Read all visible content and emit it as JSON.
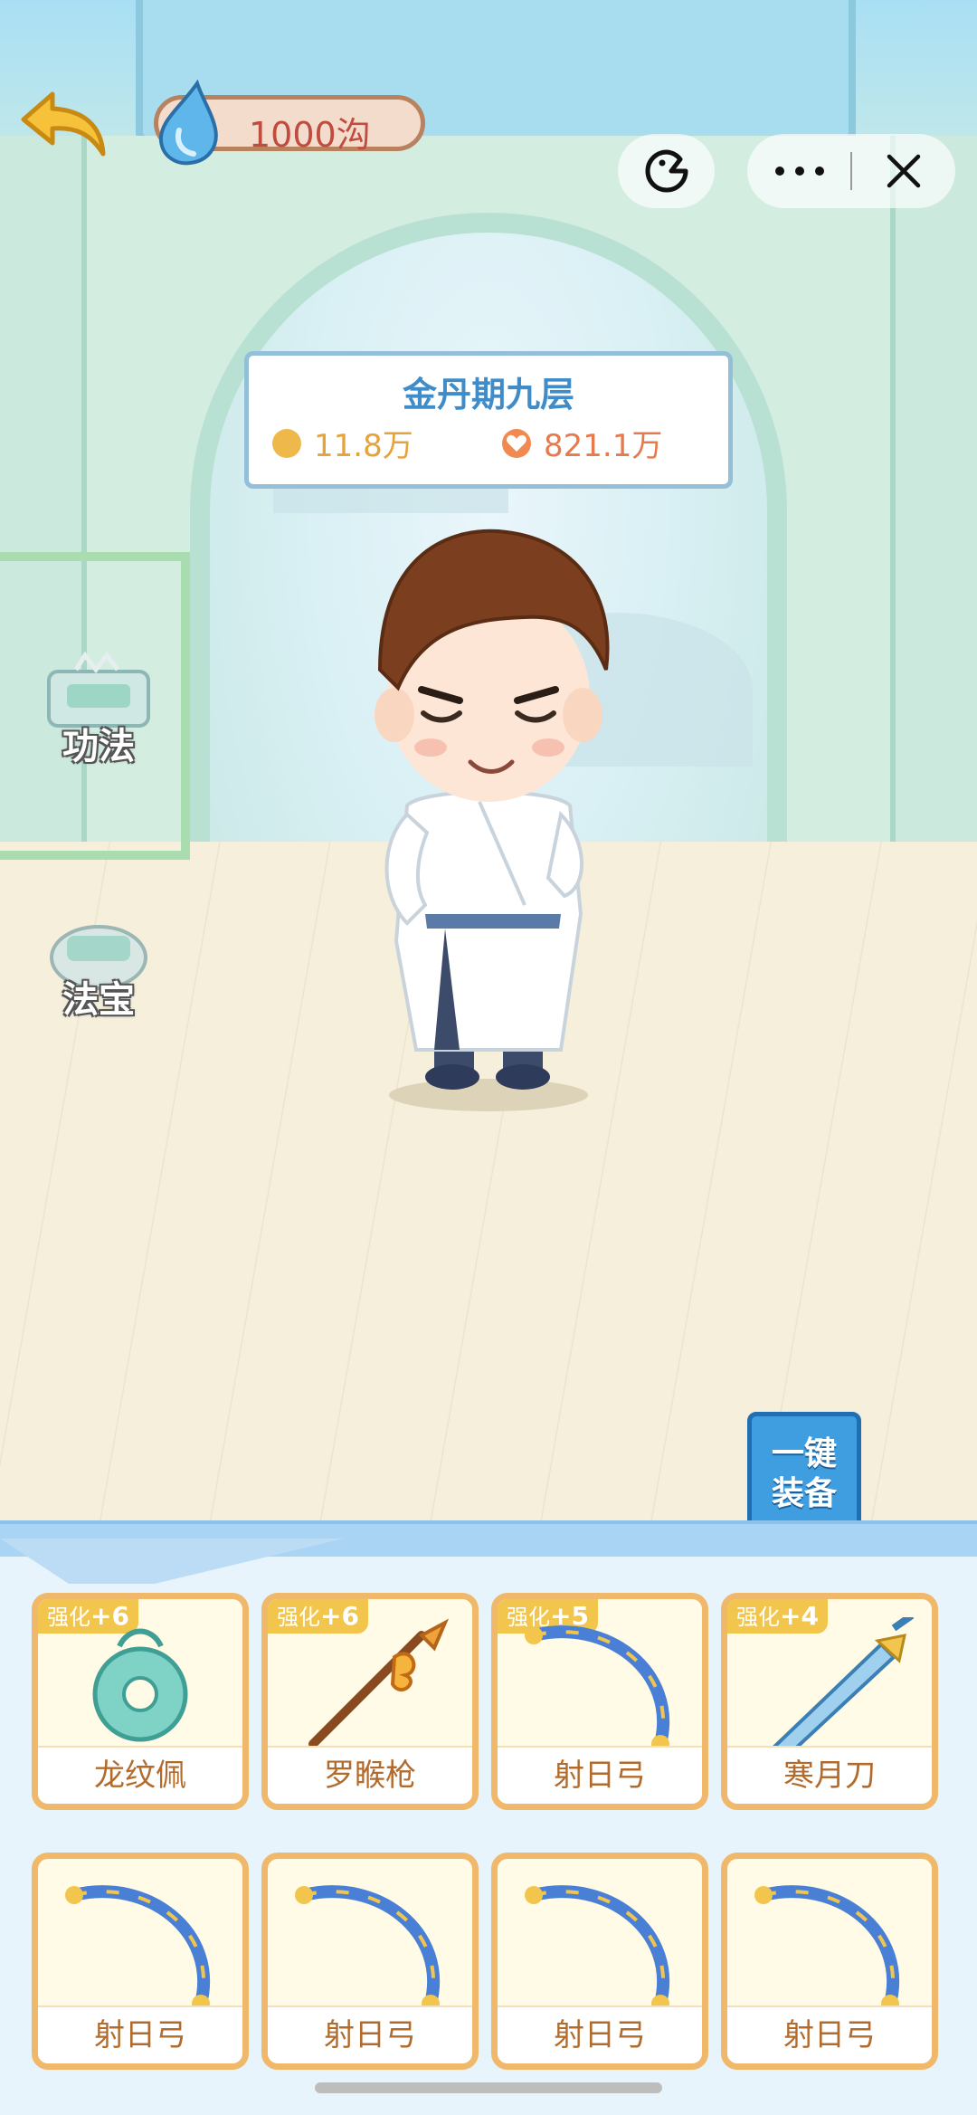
{
  "header": {
    "currency": "1000沟"
  },
  "realm": {
    "title": "金丹期九层",
    "gold": "11.8万",
    "hp": "821.1万"
  },
  "side_menu": {
    "skills_label": "功法",
    "treasure_label": "法宝"
  },
  "equip_all_label_line1": "一键",
  "equip_all_label_line2": "装备",
  "slots": [
    {
      "badge_prefix": "强化",
      "badge_level": "+6",
      "name": "龙纹佩",
      "icon": "jade-pendant-icon"
    },
    {
      "badge_prefix": "强化",
      "badge_level": "+6",
      "name": "罗睺枪",
      "icon": "spear-icon"
    },
    {
      "badge_prefix": "强化",
      "badge_level": "+5",
      "name": "射日弓",
      "icon": "bow-icon"
    },
    {
      "badge_prefix": "强化",
      "badge_level": "+4",
      "name": "寒月刀",
      "icon": "blade-icon"
    },
    {
      "name": "射日弓",
      "icon": "bow-icon"
    },
    {
      "name": "射日弓",
      "icon": "bow-icon"
    },
    {
      "name": "射日弓",
      "icon": "bow-icon"
    },
    {
      "name": "射日弓",
      "icon": "bow-icon"
    }
  ],
  "colors": {
    "accent_blue": "#3f8cc8",
    "gold": "#e6a23b",
    "hp": "#e67a4c",
    "slot_border": "#f0b86a"
  }
}
